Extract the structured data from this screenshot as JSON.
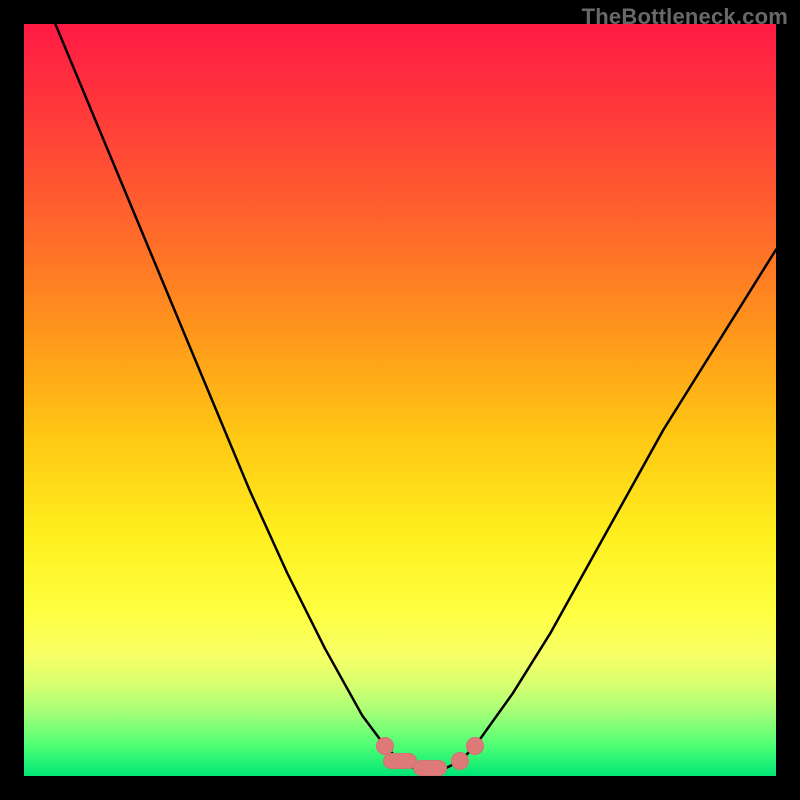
{
  "watermark": "TheBottleneck.com",
  "colors": {
    "background": "#000000",
    "watermark_text": "#686868",
    "marker": "#dd7a78",
    "curve": "#000000",
    "gradient_top": "#ff1a44",
    "gradient_bottom": "#00e676"
  },
  "chart_data": {
    "type": "line",
    "title": "",
    "xlabel": "",
    "ylabel": "",
    "xlim": [
      0,
      100
    ],
    "ylim": [
      0,
      100
    ],
    "grid": false,
    "legend": null,
    "series": [
      {
        "name": "curve",
        "x": [
          0,
          5,
          10,
          15,
          20,
          25,
          30,
          35,
          40,
          45,
          48,
          50,
          52,
          54,
          56,
          58,
          60,
          65,
          70,
          75,
          80,
          85,
          90,
          95,
          100
        ],
        "y": [
          110,
          98,
          86,
          74,
          62,
          50,
          38,
          27,
          17,
          8,
          4,
          2,
          1,
          1,
          1,
          2,
          4,
          11,
          19,
          28,
          37,
          46,
          54,
          62,
          70
        ]
      }
    ],
    "markers": [
      {
        "x": 48,
        "y": 4,
        "shape": "round"
      },
      {
        "x": 50,
        "y": 2,
        "shape": "pill"
      },
      {
        "x": 54,
        "y": 1,
        "shape": "pill"
      },
      {
        "x": 58,
        "y": 2,
        "shape": "round"
      },
      {
        "x": 60,
        "y": 4,
        "shape": "round"
      }
    ]
  }
}
